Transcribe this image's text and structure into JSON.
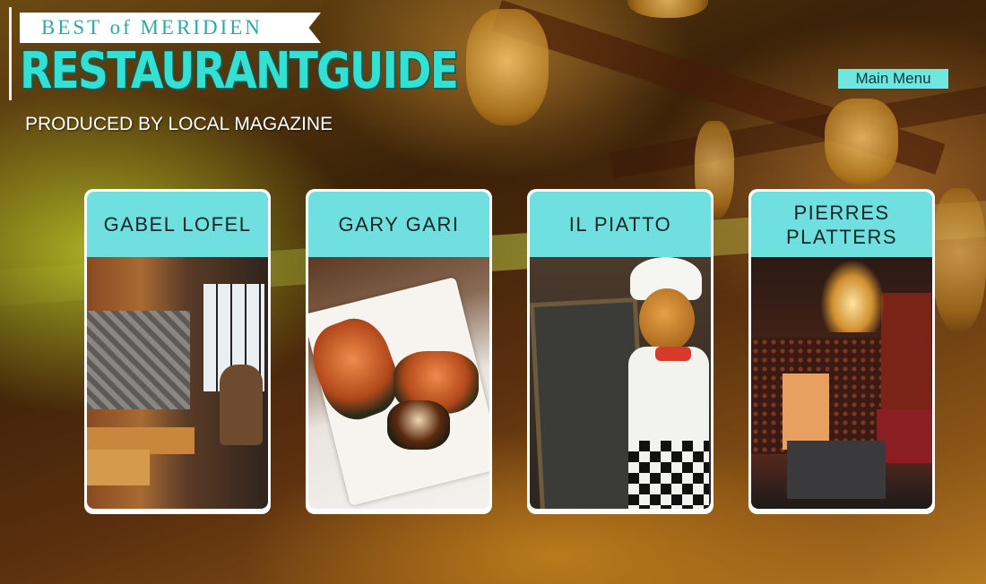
{
  "header": {
    "banner_text": "BEST of MERIDIEN",
    "title": "RESTAURANTGUIDE",
    "subtitle": "PRODUCED BY LOCAL MAGAZINE"
  },
  "nav": {
    "main_menu_label": "Main Menu"
  },
  "colors": {
    "accent_teal": "#34e0d2",
    "card_label_bg": "#6fe0df",
    "card_border": "#ffffff"
  },
  "restaurants": [
    {
      "name": "GABEL LOFEL"
    },
    {
      "name": "GARY GARI"
    },
    {
      "name": "IL PIATTO"
    },
    {
      "name": "PIERRES PLATTERS"
    }
  ]
}
